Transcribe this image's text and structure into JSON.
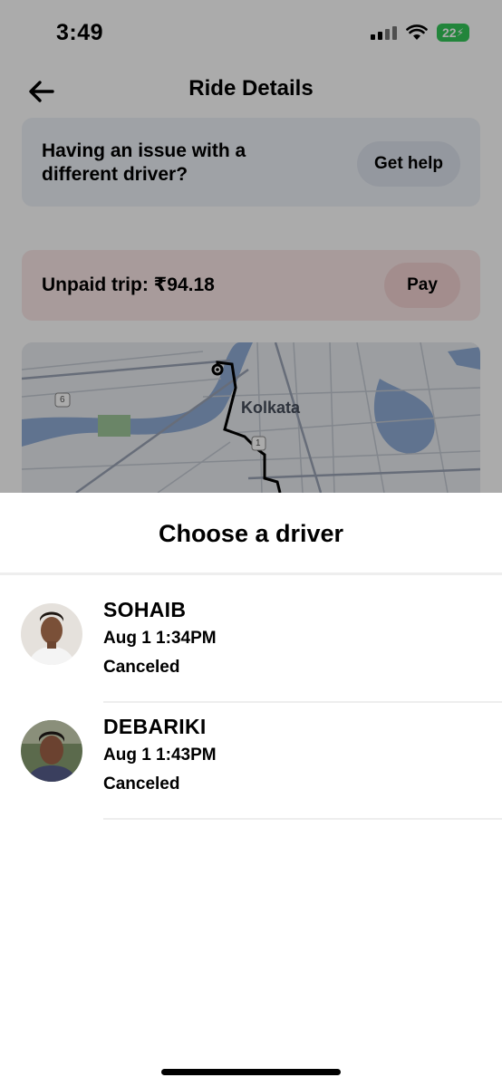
{
  "status_bar": {
    "time": "3:49",
    "battery": "22"
  },
  "header": {
    "title": "Ride Details"
  },
  "help_card": {
    "text": "Having an issue with a different driver?",
    "button": "Get help"
  },
  "unpaid_card": {
    "text": "Unpaid trip: ₹94.18",
    "button": "Pay"
  },
  "map": {
    "city_label": "Kolkata",
    "route_badge_1": "1",
    "route_badge_6": "6"
  },
  "sheet": {
    "title": "Choose a driver",
    "drivers": [
      {
        "name": "SOHAIB",
        "time": "Aug 1 1:34PM",
        "status": "Canceled"
      },
      {
        "name": "DEBARIKI",
        "time": "Aug 1 1:43PM",
        "status": "Canceled"
      }
    ]
  },
  "colors": {
    "help_bg": "#eef2f8",
    "unpaid_bg": "#fbe8e8",
    "battery": "#34c759",
    "water": "#7fa3d1"
  },
  "icons": {
    "back": "arrow-left-icon",
    "wifi": "wifi-icon",
    "signal": "cellular-signal-icon"
  }
}
